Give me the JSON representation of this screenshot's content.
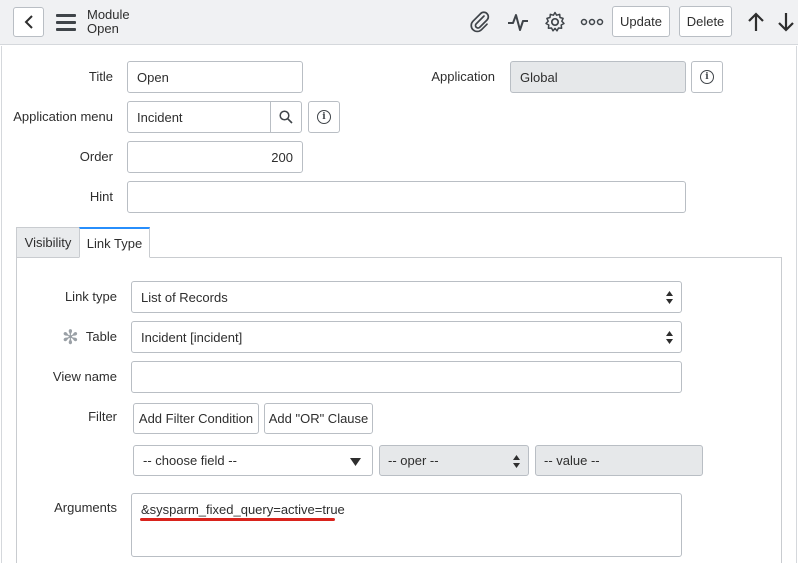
{
  "header": {
    "module_label": "Module",
    "record_name": "Open",
    "update_label": "Update",
    "delete_label": "Delete",
    "icons": [
      "back-icon",
      "menu-icon",
      "paperclip-icon",
      "activity-icon",
      "gear-icon",
      "more-icon",
      "arrow-up-icon",
      "arrow-down-icon"
    ]
  },
  "form": {
    "title_label": "Title",
    "title_value": "Open",
    "application_label": "Application",
    "application_value": "Global",
    "app_menu_label": "Application menu",
    "app_menu_value": "Incident",
    "order_label": "Order",
    "order_value": "200",
    "hint_label": "Hint",
    "hint_value": ""
  },
  "tabs": [
    {
      "label": "Visibility",
      "active": false
    },
    {
      "label": "Link Type",
      "active": true
    }
  ],
  "link_type": {
    "link_type_label": "Link type",
    "link_type_value": "List of Records",
    "table_label": "Table",
    "table_value": "Incident [incident]",
    "view_name_label": "View name",
    "view_name_value": "",
    "filter_label": "Filter",
    "add_filter_label": "Add Filter Condition",
    "add_or_label": "Add \"OR\" Clause",
    "choose_field": "-- choose field --",
    "oper": "-- oper --",
    "value": "-- value --",
    "arguments_label": "Arguments",
    "arguments_value": "&sysparm_fixed_query=active=true"
  },
  "colors": {
    "accent": "#278efc",
    "annotation": "#d9231c",
    "header_bg": "#f0f1f3"
  }
}
